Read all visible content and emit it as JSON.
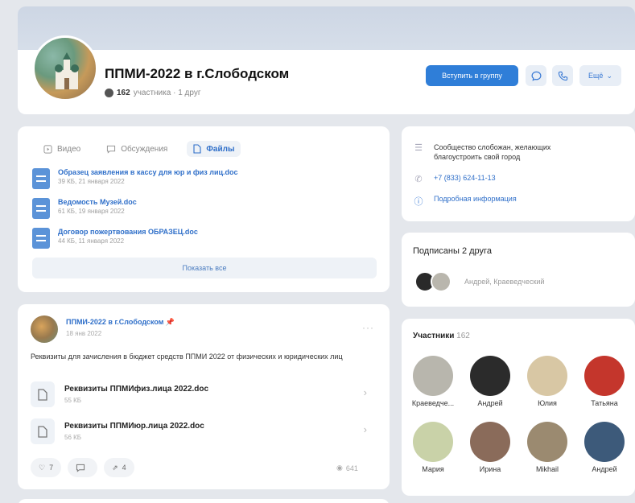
{
  "group": {
    "title": "ППМИ-2022 в г.Слободском",
    "members_count": "162",
    "members_label": "участника · 1 друг",
    "join_label": "Вступить в группу",
    "more_label": "Ещё"
  },
  "tabs": [
    {
      "label": "Видео",
      "icon": "video-icon"
    },
    {
      "label": "Обсуждения",
      "icon": "discussion-icon"
    },
    {
      "label": "Файлы",
      "icon": "file-icon",
      "active": true
    }
  ],
  "files": [
    {
      "name": "Образец заявления в кассу для юр и физ лиц.doc",
      "info": "39 КБ, 21 января 2022"
    },
    {
      "name": "Ведомость Музей.doc",
      "info": "61 КБ, 19 января 2022"
    },
    {
      "name": "Договор пожертвования ОБРАЗЕЦ.doc",
      "info": "44 КБ, 11 января 2022"
    }
  ],
  "show_all": "Показать все",
  "info": {
    "description": "Сообщество слобожан, желающих благоустроить свой город",
    "phone": "+7 (833) 624-11-13",
    "details": "Подробная информация"
  },
  "friends": {
    "title": "Подписаны 2 друга",
    "names": "Андрей, Краеведческий"
  },
  "members": {
    "title": "Участники",
    "count": "162",
    "list": [
      {
        "name": "Краеведче...",
        "color": "#b8b6ad"
      },
      {
        "name": "Андрей",
        "color": "#2b2b2b"
      },
      {
        "name": "Юлия",
        "color": "#d8c7a4"
      },
      {
        "name": "Татьяна",
        "color": "#c4362c"
      },
      {
        "name": "Мария",
        "color": "#c9d2a8"
      },
      {
        "name": "Ирина",
        "color": "#8a6b5a"
      },
      {
        "name": "Mikhail",
        "color": "#9b8a70"
      },
      {
        "name": "Андрей",
        "color": "#3d5a7a"
      }
    ]
  },
  "post": {
    "author": "ППМИ-2022 в г.Слободском",
    "date": "18 янв 2022",
    "text": "Реквизиты для зачисления в бюджет средств ППМИ 2022 от физических и юридических лиц",
    "attachments": [
      {
        "name": "Реквизиты ППМИфиз.лица 2022.doc",
        "size": "55 КБ"
      },
      {
        "name": "Реквизиты ППМИюр.лица 2022.doc",
        "size": "56 КБ"
      }
    ],
    "likes": "7",
    "comments": "",
    "shares": "4",
    "views": "641"
  }
}
